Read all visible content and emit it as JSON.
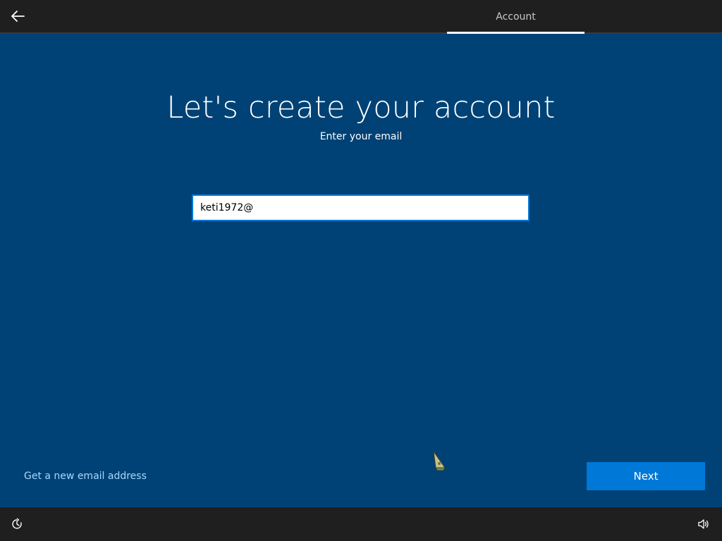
{
  "header": {
    "back_icon": "arrow-left-icon",
    "tab_label": "Account"
  },
  "main": {
    "title": "Let's create your account",
    "subtitle": "Enter your email",
    "email_value": "keti1972@",
    "new_email_link": "Get a new email address",
    "next_label": "Next"
  },
  "footer": {
    "ease_of_access_icon": "ease-of-access-icon",
    "volume_icon": "volume-icon"
  },
  "colors": {
    "background": "#004275",
    "bars": "#1f1f1f",
    "accent": "#0078d7",
    "link": "#a6d8ff"
  }
}
